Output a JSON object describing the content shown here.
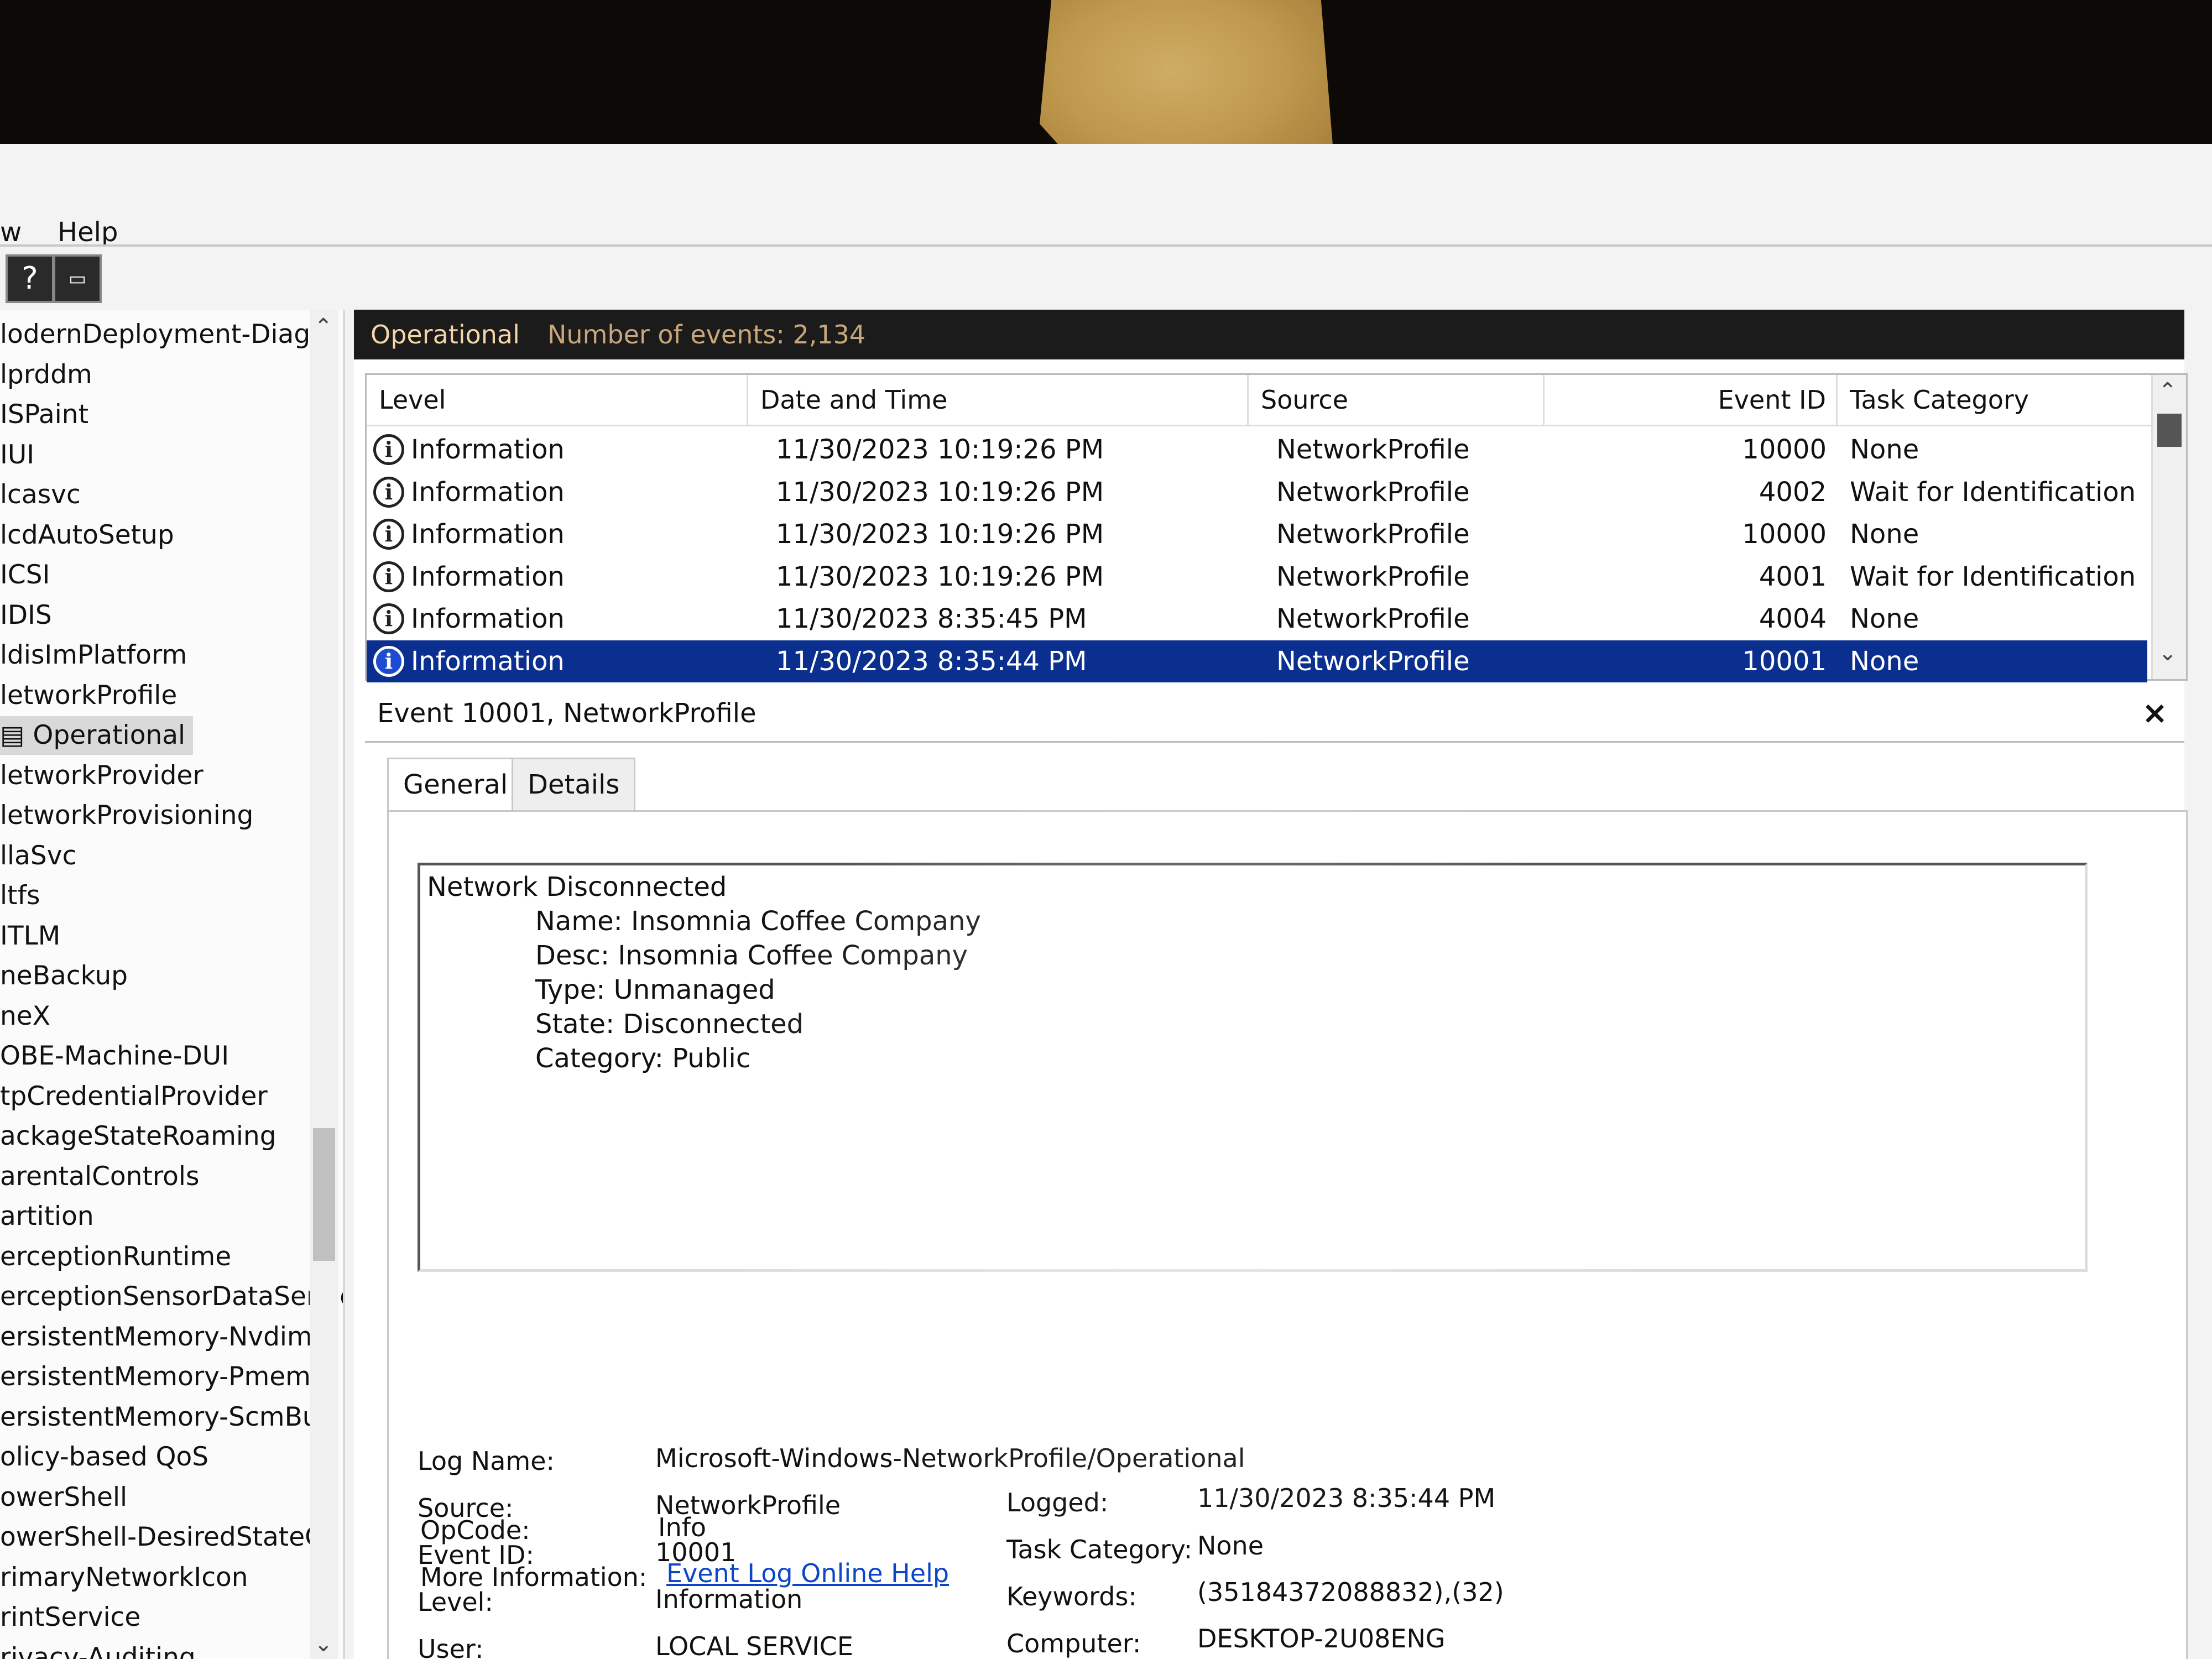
{
  "menu": {
    "view_partial": "w",
    "help": "Help"
  },
  "toolbar": {
    "help_icon": "?"
  },
  "tree": {
    "items": [
      "lodernDeployment-Diagn",
      "lprddm",
      "ISPaint",
      "IUI",
      "lcasvc",
      "lcdAutoSetup",
      "ICSI",
      "IDIS",
      "ldisImPlatform",
      "letworkProfile",
      "Operational",
      "letworkProvider",
      "letworkProvisioning",
      "llaSvc",
      "ltfs",
      "ITLM",
      "neBackup",
      "neX",
      "OBE-Machine-DUI",
      "tpCredentialProvider",
      "ackageStateRoaming",
      "arentalControls",
      "artition",
      "erceptionRuntime",
      "erceptionSensorDataServic",
      "ersistentMemory-Nvdimm",
      "ersistentMemory-PmemD",
      "ersistentMemory-ScmBus",
      "olicy-based QoS",
      "owerShell",
      "owerShell-DesiredStateCo",
      "rimaryNetworkIcon",
      "rintService",
      "rivacy-Auditing"
    ],
    "selected_index": 10
  },
  "pane": {
    "title": "Operational",
    "count_label": "Number of events: 2,134"
  },
  "grid": {
    "columns": [
      "Level",
      "Date and Time",
      "Source",
      "Event ID",
      "Task Category"
    ],
    "rows": [
      {
        "level": "Information",
        "datetime": "11/30/2023 10:19:26 PM",
        "source": "NetworkProfile",
        "event_id": "10000",
        "task": "None"
      },
      {
        "level": "Information",
        "datetime": "11/30/2023 10:19:26 PM",
        "source": "NetworkProfile",
        "event_id": "4002",
        "task": "Wait for Identification"
      },
      {
        "level": "Information",
        "datetime": "11/30/2023 10:19:26 PM",
        "source": "NetworkProfile",
        "event_id": "10000",
        "task": "None"
      },
      {
        "level": "Information",
        "datetime": "11/30/2023 10:19:26 PM",
        "source": "NetworkProfile",
        "event_id": "4001",
        "task": "Wait for Identification"
      },
      {
        "level": "Information",
        "datetime": "11/30/2023 8:35:45 PM",
        "source": "NetworkProfile",
        "event_id": "4004",
        "task": "None"
      },
      {
        "level": "Information",
        "datetime": "11/30/2023 8:35:44 PM",
        "source": "NetworkProfile",
        "event_id": "10001",
        "task": "None"
      }
    ],
    "selected_index": 5
  },
  "detail": {
    "title": "Event 10001, NetworkProfile",
    "close": "×",
    "tabs": [
      "General",
      "Details"
    ],
    "message": [
      "Network Disconnected",
      "Name: Insomnia Coffee Company",
      "Desc: Insomnia Coffee Company",
      "Type: Unmanaged",
      "State: Disconnected",
      "Category: Public"
    ],
    "fields": {
      "log_name_label": "Log Name:",
      "log_name": "Microsoft-Windows-NetworkProfile/Operational",
      "source_label": "Source:",
      "source": "NetworkProfile",
      "logged_label": "Logged:",
      "logged": "11/30/2023 8:35:44 PM",
      "event_id_label": "Event ID:",
      "event_id": "10001",
      "task_category_label": "Task Category:",
      "task_category": "None",
      "level_label": "Level:",
      "level": "Information",
      "keywords_label": "Keywords:",
      "keywords": "(35184372088832),(32)",
      "user_label": "User:",
      "user": "LOCAL SERVICE",
      "computer_label": "Computer:",
      "computer": "DESKTOP-2U08ENG",
      "opcode_label": "OpCode:",
      "opcode": "Info",
      "more_info_label": "More Information:",
      "more_info_link": "Event Log Online Help"
    }
  },
  "colors": {
    "selection": "#0a2f8f",
    "link": "#0b46c9",
    "header_bg": "#1b1b1b",
    "header_text": "#f2d6a8"
  }
}
